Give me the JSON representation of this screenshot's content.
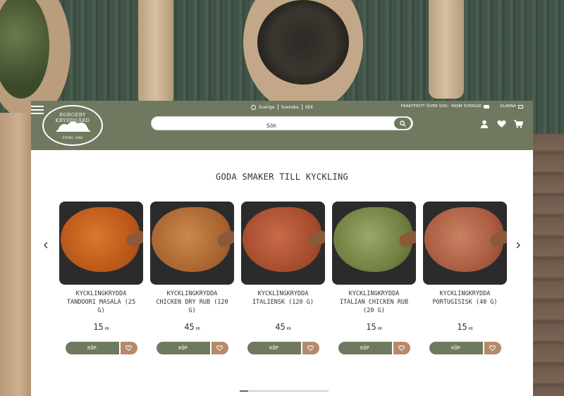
{
  "topbar": {
    "country": "Sverige",
    "language": "Svenska",
    "currency": "SEK",
    "shipping_notice": "FRAKTFRITT ÖVER 500:- INOM SVERIGE",
    "payment": "KLARNA"
  },
  "logo": {
    "name": "BORGEBY KRYDDGÅRD",
    "established": "ETABL 1988"
  },
  "search": {
    "placeholder": "Sök"
  },
  "section": {
    "title": "GODA SMAKER TILL KYCKLING"
  },
  "products": [
    {
      "name": "KYCKLINGKRYDDA TANDOORI MASALA (25 G)",
      "price": "15",
      "currency": "KR",
      "buy_label": "KÖP",
      "color": "#c8621f"
    },
    {
      "name": "KYCKLINGKRYDDA CHICKEN DRY RUB (120 G)",
      "price": "45",
      "currency": "KR",
      "buy_label": "KÖP",
      "color": "#b86a35"
    },
    {
      "name": "KYCKLINGKRYDDA ITALIENSK (120 G)",
      "price": "45",
      "currency": "KR",
      "buy_label": "KÖP",
      "color": "#b85e3c"
    },
    {
      "name": "KYCKLINGKRYDDA ITALIAN CHICKEN RUB (20 G)",
      "price": "15",
      "currency": "KR",
      "buy_label": "KÖP",
      "color": "#7a8a4a"
    },
    {
      "name": "KYCKLINGKRYDDA PORTUGISISK (40 G)",
      "price": "15",
      "currency": "KR",
      "buy_label": "KÖP",
      "color": "#b8684a"
    }
  ],
  "colors": {
    "header": "#6f7960",
    "buy_button": "#6f7960",
    "fav_button": "#b48a6a"
  }
}
